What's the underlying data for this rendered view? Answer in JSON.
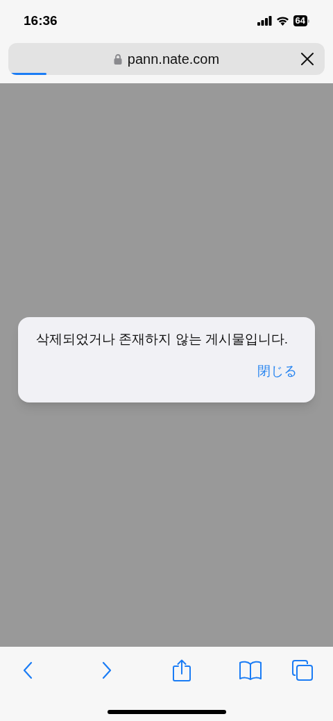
{
  "status_bar": {
    "time": "16:36",
    "battery": "64"
  },
  "address_bar": {
    "url": "pann.nate.com",
    "loading": {
      "level": 0.12
    }
  },
  "alert": {
    "message": "삭제되었거나 존재하지 않는 게시물입니다.",
    "button": "閉じる"
  }
}
